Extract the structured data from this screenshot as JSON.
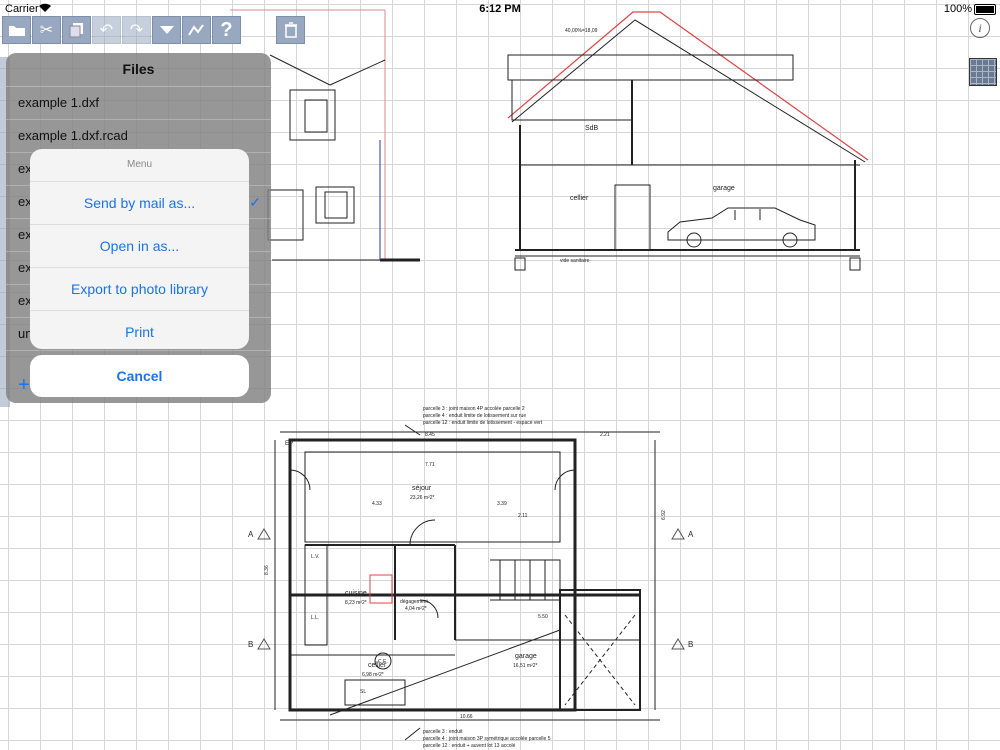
{
  "status": {
    "carrier": "Carrier",
    "time": "6:12 PM",
    "battery": "100%"
  },
  "toolbar": {
    "items": [
      "folder-icon",
      "scissors-icon",
      "copy-icon",
      "undo-icon",
      "redo-icon",
      "dropdown-icon",
      "measure-icon",
      "help-icon",
      "trash-icon"
    ]
  },
  "files": {
    "title": "Files",
    "items": [
      "example 1.dxf",
      "example 1.dxf.rcad",
      "ex",
      "ex",
      "ex",
      "ex",
      "ex",
      "un"
    ]
  },
  "menu": {
    "title": "Menu",
    "items": [
      "Send by mail as...",
      "Open in as...",
      "Export to photo library",
      "Print"
    ],
    "cancel": "Cancel"
  },
  "drawing": {
    "labels": {
      "sdb": "SdB",
      "cellier_top": "cellier",
      "garage_top": "garage",
      "vide": "vide sanitaire",
      "roof_dim": "40,00%=18,09",
      "sejour": "séjour",
      "sejour_area": "23,26 m²2*",
      "cuisine": "cuisine",
      "cuisine_area": "8,23 m²2*",
      "degagement": "dégagement",
      "degagement_area": "4,04 m²2*",
      "cellier_bottom": "cellier",
      "cellier_area": "6,98 m²2*",
      "garage_bottom": "garage",
      "garage_area": "16,51 m²2*",
      "ce": "C.E.",
      "lv": "L.V.",
      "ll": "L.L.",
      "sl": "SL",
      "ep": "EP",
      "ra": "A",
      "rb": "B",
      "dim_845": "8.45",
      "dim_771": "7.71",
      "dim_1066": "10.66",
      "dim_433": "4.33",
      "dim_339": "3.39",
      "dim_211": "2.11",
      "dim_221": "2.21",
      "dim_550": "5.50",
      "dim_836": "8.36",
      "dim_692": "6.92"
    },
    "notes_top": [
      "parcelle 3 : joint maison 4P accolée parcelle 2",
      "parcelle 4 : enduit limite de lotissement sur rue",
      "parcelle 12 : enduit limite de lotissement - espace vert"
    ],
    "notes_bottom": [
      "parcelle 3 : enduit",
      "parcelle 4 : joint maison 3P symétrique accolée parcelle 5",
      "parcelle 12 : enduit + auvent lot 13 accolé"
    ]
  }
}
